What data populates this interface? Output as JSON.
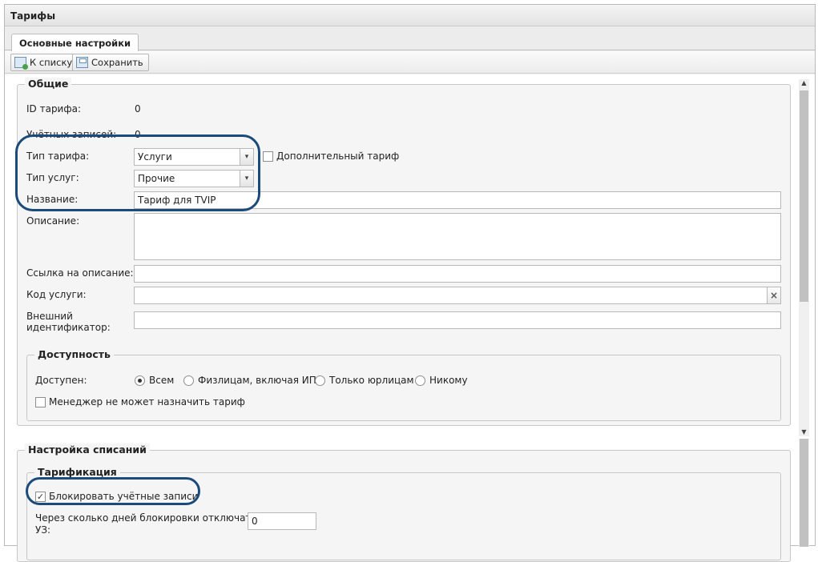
{
  "window": {
    "title": "Тарифы"
  },
  "tabs": [
    {
      "label": "Основные настройки",
      "active": true
    }
  ],
  "toolbar": {
    "back_label": "К списку",
    "save_label": "Сохранить"
  },
  "general": {
    "legend": "Общие",
    "tariff_id_label": "ID тарифа:",
    "tariff_id_value": "0",
    "accounts_label": "Учётных записей:",
    "accounts_value": "0",
    "tariff_type_label": "Тип тарифа:",
    "tariff_type_value": "Услуги",
    "additional_tariff_label": "Дополнительный тариф",
    "additional_tariff_checked": false,
    "service_type_label": "Тип услуг:",
    "service_type_value": "Прочие",
    "name_label": "Название:",
    "name_value": "Тариф для TVIP",
    "description_label": "Описание:",
    "description_value": "",
    "link_label": "Ссылка на описание:",
    "link_value": "",
    "service_code_label": "Код услуги:",
    "service_code_value": "",
    "clear_symbol": "×",
    "external_id_label_line1": "Внешний",
    "external_id_label_line2": "идентификатор:",
    "external_id_value": ""
  },
  "availability": {
    "legend": "Доступность",
    "available_label": "Доступен:",
    "options": [
      "Всем",
      "Физлицам, включая ИП",
      "Только юрлицам",
      "Никому"
    ],
    "selected": "Всем",
    "manager_cannot_assign_label": "Менеджер не может назначить тариф",
    "manager_cannot_assign_checked": false
  },
  "writeoffs": {
    "legend": "Настройка списаний",
    "tariffication": {
      "legend": "Тарификация",
      "block_accounts_label": "Блокировать учётные записи",
      "block_accounts_checked": true,
      "days_label_line1": "Через сколько дней блокировки отключать",
      "days_label_line2": "УЗ:",
      "days_value": "0"
    }
  },
  "icons": {
    "dropdown": "▾",
    "check": "✓",
    "scroll_up": "▲",
    "scroll_down": "▼"
  },
  "colors": {
    "highlight": "#1a4b7a"
  }
}
